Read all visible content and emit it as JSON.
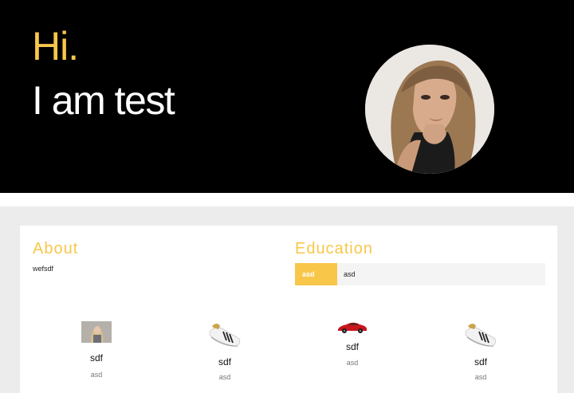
{
  "hero": {
    "greeting": "Hi.",
    "name": "I am test"
  },
  "about": {
    "title": "About",
    "text": "wefsdf"
  },
  "education": {
    "title": "Education",
    "entries": [
      {
        "badge": "asd",
        "value": "asd"
      }
    ]
  },
  "items": [
    {
      "title": "sdf",
      "desc": "asd",
      "icon": "portrait-photo"
    },
    {
      "title": "sdf",
      "desc": "asd",
      "icon": "sneaker-photo"
    },
    {
      "title": "sdf",
      "desc": "asd",
      "icon": "red-car-photo"
    },
    {
      "title": "sdf",
      "desc": "asd",
      "icon": "sneaker-photo"
    }
  ],
  "colors": {
    "accent": "#f8c74a",
    "hero_bg": "#000000",
    "page_bg": "#ececec",
    "card_bg": "#ffffff"
  }
}
